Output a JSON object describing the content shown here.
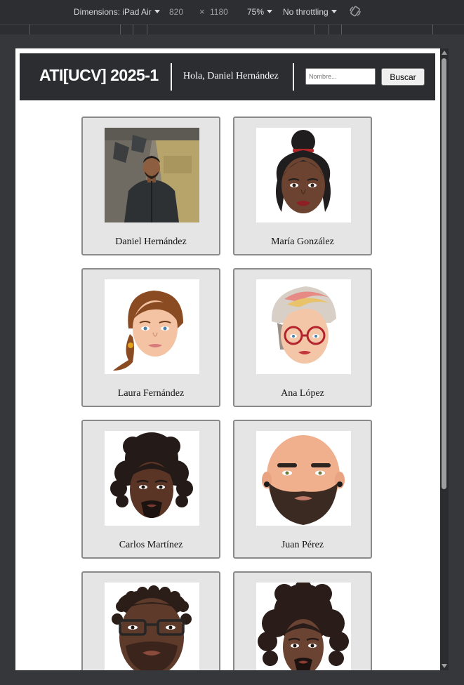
{
  "devtools": {
    "dimensions_label": "Dimensions: iPad Air",
    "width": "820",
    "times": "×",
    "height": "1180",
    "zoom": "75%",
    "throttling": "No throttling"
  },
  "header": {
    "brand": "ATI[UCV] 2025-1",
    "greeting": "Hola, Daniel Hernández",
    "search_placeholder": "Nombre...",
    "search_button": "Buscar"
  },
  "students": [
    {
      "name": "Daniel Hernández",
      "avatar": "photo-portrait"
    },
    {
      "name": "María González",
      "avatar": "cartoon-woman-bun"
    },
    {
      "name": "Laura Fernández",
      "avatar": "cartoon-woman-ponytail"
    },
    {
      "name": "Ana López",
      "avatar": "cartoon-woman-glasses"
    },
    {
      "name": "Carlos Martínez",
      "avatar": "cartoon-man-curly"
    },
    {
      "name": "Juan Pérez",
      "avatar": "cartoon-man-beard"
    },
    {
      "name": "",
      "avatar": "cartoon-man-glasses"
    },
    {
      "name": "",
      "avatar": "cartoon-man-dreadlocks"
    }
  ],
  "colors": {
    "header_bg": "#2b2d31",
    "card_bg": "#e5e5e5",
    "card_border": "#8a8a8a"
  }
}
